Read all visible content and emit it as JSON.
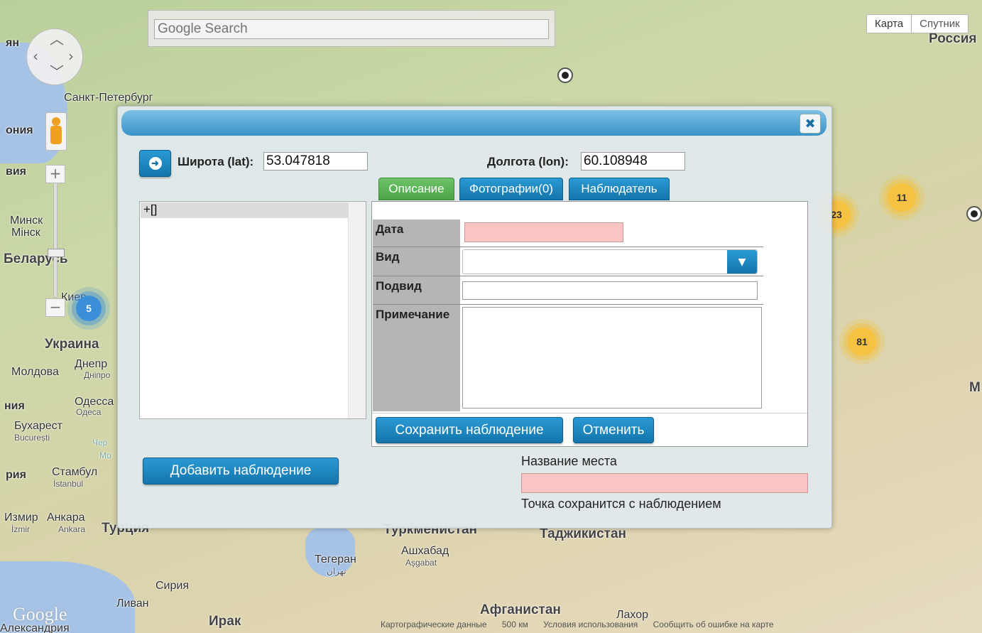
{
  "search": {
    "placeholder": "Google Search"
  },
  "map_type": {
    "map": "Карта",
    "satellite": "Спутник"
  },
  "map_labels": {
    "russia": "Россия",
    "spb": "Санкт-Петербург",
    "minsk": "Минск",
    "minsk_by": "Мінск",
    "belarus": "Беларусь",
    "kiev": "Киев",
    "ukraine": "Украина",
    "dnepr": "Днепр",
    "dnipro": "Дніпро",
    "moldova": "Молдова",
    "odessa": "Одесса",
    "odesa": "Одеса",
    "bucharest": "Бухарест",
    "bucuresti": "București",
    "istanbul": "Стамбул",
    "istanbul_tr": "İstanbul",
    "izmir": "Измир",
    "izmir_tr": "İzmir",
    "ankara": "Анкара",
    "ankara_tr": "Ankara",
    "turkey": "Турция",
    "turkmenistan": "Туркменистан",
    "tajikistan": "Таджикистан",
    "ashgabat": "Ашхабад",
    "ashgabat_tk": "Aşgabat",
    "tehran": "Тегеран",
    "tehran_fa": "تهران",
    "syria": "Сирия",
    "lebanon": "Ливан",
    "iraq": "Ирак",
    "afghanistan": "Афганистан",
    "lahore": "Лахор",
    "alexandria": "Александрия",
    "left_nia": "ния",
    "left_via": "вия",
    "left_ria": "рия",
    "left_nia2": "ония",
    "left_yan": "ян",
    "right_m": "М",
    "chern": "Чер",
    "mo": "Мо"
  },
  "clusters": {
    "c5": "5",
    "c11": "11",
    "c23": "23",
    "c81": "81"
  },
  "credits": {
    "mapdata": "Картографические данные",
    "scale": "500 км",
    "terms": "Условия использования",
    "report": "Сообщить об ошибке на карте"
  },
  "google_logo": "Google",
  "dialog": {
    "close_icon": "✖",
    "lat_label": "Широта (lat):",
    "lat_value": "53.047818",
    "lon_label": "Долгота (lon):",
    "lon_value": "60.108948",
    "tree_item": "+[]",
    "tabs": {
      "description": "Описание",
      "photos": "Фотографии(0)",
      "observer": "Наблюдатель"
    },
    "fields": {
      "date": "Дата",
      "species": "Вид",
      "subspecies": "Подвид",
      "note": "Примечание"
    },
    "save": "Сохранить наблюдение",
    "cancel": "Отменить",
    "add": "Добавить наблюдение",
    "place_label": "Название места",
    "place_note": "Точка сохранится с наблюдением"
  }
}
